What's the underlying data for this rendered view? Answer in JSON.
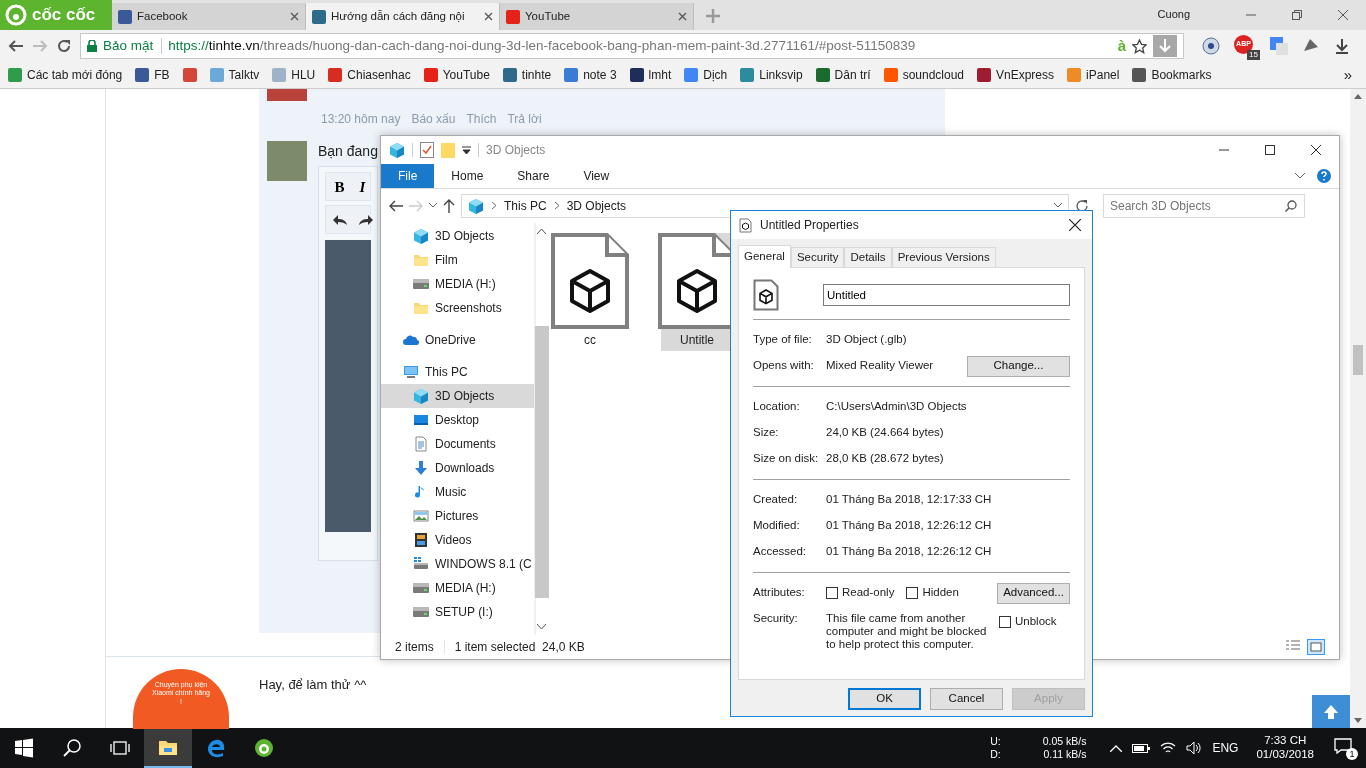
{
  "browser": {
    "brand": "cốc cốc",
    "tabs": [
      {
        "title": "Facebook",
        "selected": false,
        "color": "#3b5998"
      },
      {
        "title": "Hướng dẫn cách đăng nội",
        "selected": true,
        "color": "#2e6b8a"
      },
      {
        "title": "YouTube",
        "selected": false,
        "color": "#e62117"
      }
    ],
    "user": "Cuong",
    "security_label": "Bảo mật",
    "url": {
      "scheme": "https://",
      "host": "tinhte.vn",
      "path": "/threads/huong-dan-cach-dang-noi-dung-3d-len-facebook-bang-phan-mem-paint-3d.2771161/#post-51150839"
    },
    "address_mark": "à",
    "adblock_label": "ABP",
    "adblock_count": "15",
    "bookmarks": [
      {
        "label": "Các tab mới đóng",
        "color": "#2e9c4a"
      },
      {
        "label": "FB",
        "color": "#3b5998"
      },
      {
        "color": "#d44638"
      },
      {
        "label": "Talktv",
        "color": "#6aa9d8"
      },
      {
        "label": "HLU",
        "color": "#9fb3c8"
      },
      {
        "label": "Chiasenhac",
        "color": "#d62d20"
      },
      {
        "label": "YouTube",
        "color": "#e62117"
      },
      {
        "label": "tinhte",
        "color": "#2e6b8a"
      },
      {
        "label": "note 3",
        "color": "#3a7bd5"
      },
      {
        "label": "lmht",
        "color": "#1e2d5a"
      },
      {
        "label": "Dịch",
        "color": "#4285f4"
      },
      {
        "label": "Linksvip",
        "color": "#2a8c9c"
      },
      {
        "label": "Dân trí",
        "color": "#1c6b2e"
      },
      {
        "label": "soundcloud",
        "color": "#ff5500"
      },
      {
        "label": "VnExpress",
        "color": "#9d1c2f"
      },
      {
        "label": "iPanel",
        "color": "#f08a24"
      },
      {
        "label": "Bookmarks",
        "color": "#555555"
      }
    ],
    "overflow": "»"
  },
  "page": {
    "post_meta": [
      "13:20 hôm nay",
      "Báo xấu",
      "Thích",
      "Trả lời"
    ],
    "reply_prompt": "Bạn đang",
    "editor_buttons": [
      "B",
      "I"
    ],
    "comment": "Hay, để làm thử ^^",
    "ad_text": "Chuyên phụ kiện Xiaomi chính hãng !"
  },
  "explorer": {
    "title": "3D Objects",
    "ribbon_tabs": [
      {
        "label": "File",
        "selected": true
      },
      {
        "label": "Home",
        "selected": false
      },
      {
        "label": "Share",
        "selected": false
      },
      {
        "label": "View",
        "selected": false
      }
    ],
    "breadcrumb": [
      "This PC",
      "3D Objects"
    ],
    "search": {
      "placeholder": "Search 3D Objects"
    },
    "quick_access": [
      {
        "label": "3D Objects",
        "kind": "cube",
        "selected": false
      },
      {
        "label": "Film",
        "kind": "folder",
        "selected": false
      },
      {
        "label": "MEDIA (H:)",
        "kind": "drive",
        "selected": false
      },
      {
        "label": "Screenshots",
        "kind": "folder",
        "selected": false
      }
    ],
    "nav": [
      {
        "label": "OneDrive",
        "kind": "cloud",
        "selected": false
      },
      {
        "label": "This PC",
        "kind": "pc",
        "selected": false,
        "children": [
          {
            "label": "3D Objects",
            "kind": "cube",
            "selected": true
          },
          {
            "label": "Desktop",
            "kind": "desktop",
            "selected": false
          },
          {
            "label": "Documents",
            "kind": "documents",
            "selected": false
          },
          {
            "label": "Downloads",
            "kind": "download",
            "selected": false
          },
          {
            "label": "Music",
            "kind": "music",
            "selected": false
          },
          {
            "label": "Pictures",
            "kind": "pictures",
            "selected": false
          },
          {
            "label": "Videos",
            "kind": "videos",
            "selected": false
          },
          {
            "label": "WINDOWS 8.1 (C",
            "kind": "windrive",
            "selected": false
          },
          {
            "label": "MEDIA (H:)",
            "kind": "drive",
            "selected": false
          },
          {
            "label": "SETUP (I:)",
            "kind": "drive",
            "selected": false
          }
        ]
      }
    ],
    "files": [
      {
        "name": "cc",
        "selected": false
      },
      {
        "name": "Untitle",
        "selected": true
      }
    ],
    "status": [
      "2 items",
      "1 item selected  24,0 KB"
    ]
  },
  "properties": {
    "title": "Untitled Properties",
    "tabs": [
      {
        "label": "General",
        "selected": true
      },
      {
        "label": "Security",
        "selected": false
      },
      {
        "label": "Details",
        "selected": false
      },
      {
        "label": "Previous Versions",
        "selected": false
      }
    ],
    "name": "Untitled",
    "groups": [
      [
        {
          "label": "Type of file:",
          "value": "3D Object (.glb)"
        },
        {
          "label": "Opens with:",
          "value": "Mixed Reality Viewer",
          "button": "Change..."
        }
      ],
      [
        {
          "label": "Location:",
          "value": "C:\\Users\\Admin\\3D Objects"
        },
        {
          "label": "Size:",
          "value": "24,0 KB (24.664 bytes)"
        },
        {
          "label": "Size on disk:",
          "value": "28,0 KB (28.672 bytes)"
        }
      ],
      [
        {
          "label": "Created:",
          "value": "01 Tháng Ba 2018, 12:17:33 CH"
        },
        {
          "label": "Modified:",
          "value": "01 Tháng Ba 2018, 12:26:12 CH"
        },
        {
          "label": "Accessed:",
          "value": "01 Tháng Ba 2018, 12:26:12 CH"
        }
      ]
    ],
    "attributes_label": "Attributes:",
    "attributes": [
      {
        "label": "Read-only",
        "checked": false
      },
      {
        "label": "Hidden",
        "checked": false
      }
    ],
    "advanced_button": "Advanced...",
    "security_label": "Security:",
    "security_text": "This file came from another computer and might be blocked to help protect this computer.",
    "unblock": {
      "label": "Unblock",
      "checked": false
    },
    "buttons": [
      {
        "label": "OK",
        "kind": "default",
        "disabled": false
      },
      {
        "label": "Cancel",
        "kind": "normal",
        "disabled": false
      },
      {
        "label": "Apply",
        "kind": "normal",
        "disabled": true
      }
    ]
  },
  "taskbar": {
    "apps": [
      {
        "kind": "explorer",
        "active": true
      },
      {
        "kind": "edge",
        "active": false
      },
      {
        "kind": "coccoc",
        "active": false
      }
    ],
    "net": [
      {
        "label": "U:",
        "value": "0.05 kB/s"
      },
      {
        "label": "D:",
        "value": "0.11 kB/s"
      }
    ],
    "language": "ENG",
    "time": "7:33 CH",
    "date": "01/03/2018",
    "notification_count": "1"
  }
}
